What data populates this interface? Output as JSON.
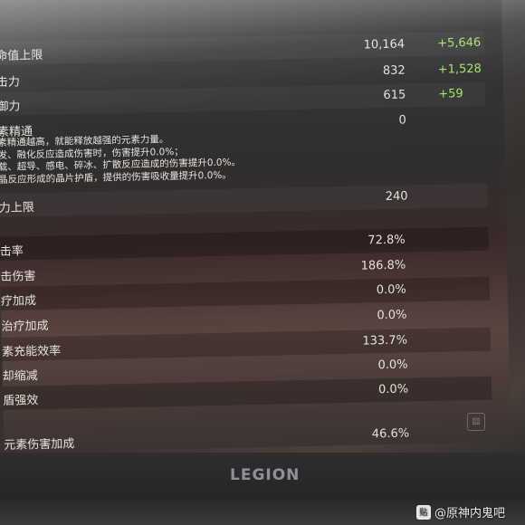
{
  "stats": [
    {
      "label": "命值上限",
      "value": "10,164",
      "bonus": "+5,646"
    },
    {
      "label": "击力",
      "value": "832",
      "bonus": "+1,528"
    },
    {
      "label": "御力",
      "value": "615",
      "bonus": "+59"
    },
    {
      "label": "素精通",
      "value": "0",
      "bonus": ""
    },
    {
      "label": "力上限",
      "value": "240",
      "bonus": ""
    },
    {
      "label": "击率",
      "value": "72.8%",
      "bonus": ""
    },
    {
      "label": "击伤害",
      "value": "186.8%",
      "bonus": ""
    },
    {
      "label": "疗加成",
      "value": "0.0%",
      "bonus": ""
    },
    {
      "label": "治疗加成",
      "value": "0.0%",
      "bonus": ""
    },
    {
      "label": "素充能效率",
      "value": "133.7%",
      "bonus": ""
    },
    {
      "label": "却缩减",
      "value": "0.0%",
      "bonus": ""
    },
    {
      "label": "盾强效",
      "value": "0.0%",
      "bonus": ""
    },
    {
      "label": "元素伤害加成",
      "value": "46.6%",
      "bonus": ""
    }
  ],
  "mastery_description": [
    "素精通越高，就能释放越强的元素力量。",
    "发、融化反应造成伤害时，伤害提升0.0%；",
    "载、超导、感电、碎冰、扩散反应造成的伤害提升0.0%。",
    "晶反应形成的晶片护盾，提供的伤害吸收量提升0.0%。"
  ],
  "device_brand": "LEGION",
  "watermark": {
    "logo": "贴",
    "text": "@原神内鬼吧"
  },
  "colors": {
    "bonus": "#a6e46a",
    "text": "#e6e3dc"
  }
}
